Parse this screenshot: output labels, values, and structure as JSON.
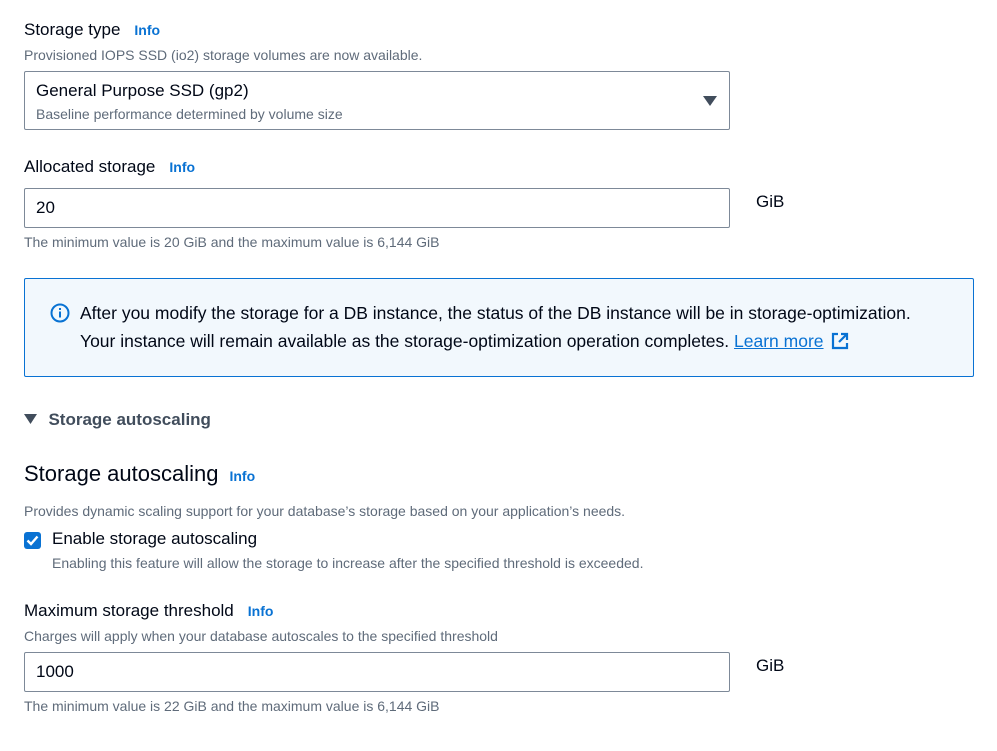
{
  "storage_type": {
    "label": "Storage type",
    "info": "Info",
    "description": "Provisioned IOPS SSD (io2) storage volumes are now available.",
    "selected_value": "General Purpose SSD (gp2)",
    "selected_description": "Baseline performance determined by volume size"
  },
  "allocated_storage": {
    "label": "Allocated storage",
    "info": "Info",
    "value": "20",
    "unit": "GiB",
    "constraint": "The minimum value is 20 GiB and the maximum value is 6,144 GiB"
  },
  "alert": {
    "line1": "After you modify the storage for a DB instance, the status of the DB instance will be in storage-optimization.",
    "line2": "Your instance will remain available as the storage-optimization operation completes.",
    "link": "Learn more"
  },
  "autoscaling_section": {
    "toggle_label": "Storage autoscaling",
    "heading": "Storage autoscaling",
    "info": "Info",
    "description": "Provides dynamic scaling support for your database’s storage based on your application’s needs.",
    "checkbox_label": "Enable storage autoscaling",
    "checkbox_checked": true,
    "checkbox_description": "Enabling this feature will allow the storage to increase after the specified threshold is exceeded."
  },
  "max_threshold": {
    "label": "Maximum storage threshold",
    "info": "Info",
    "description": "Charges will apply when your database autoscales to the specified threshold",
    "value": "1000",
    "unit": "GiB",
    "constraint": "The minimum value is 22 GiB and the maximum value is 6,144 GiB"
  },
  "colors": {
    "accent": "#0972d3",
    "alert_bg": "#f2f8fd",
    "text": "#000716",
    "secondary_text": "#5f6b7a"
  }
}
